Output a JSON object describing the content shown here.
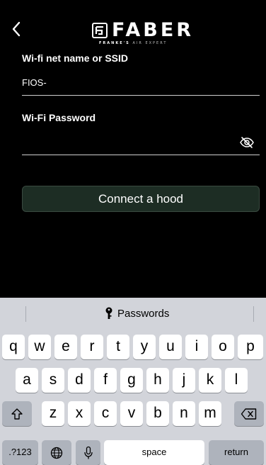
{
  "header": {
    "back_icon": "chevron-left-icon",
    "logo_word": "FABER",
    "logo_tagline_bold": "FRANKE'S",
    "logo_tagline_rest": "AIR EXPERT"
  },
  "form": {
    "ssid_label": "Wi-fi net name or SSID",
    "ssid_value": "FIOS-",
    "password_label": "Wi-Fi Password",
    "password_value": "",
    "visibility_icon": "eye-slash-icon",
    "connect_label": "Connect a hood"
  },
  "keyboard": {
    "suggestion": "Passwords",
    "suggestion_icon": "key-icon",
    "row1": [
      "q",
      "w",
      "e",
      "r",
      "t",
      "y",
      "u",
      "i",
      "o",
      "p"
    ],
    "row2": [
      "a",
      "s",
      "d",
      "f",
      "g",
      "h",
      "j",
      "k",
      "l"
    ],
    "row3": [
      "z",
      "x",
      "c",
      "v",
      "b",
      "n",
      "m"
    ],
    "shift_icon": "shift-icon",
    "delete_icon": "backspace-icon",
    "numbers_label": ".?123",
    "globe_icon": "globe-icon",
    "mic_icon": "microphone-icon",
    "space_label": "space",
    "return_label": "return"
  },
  "colors": {
    "background": "#000000",
    "button_fill": "#1d2d24",
    "keyboard_bg": "#d2d4da",
    "key_fill": "#ffffff",
    "function_key_fill": "#aeb3bc"
  }
}
